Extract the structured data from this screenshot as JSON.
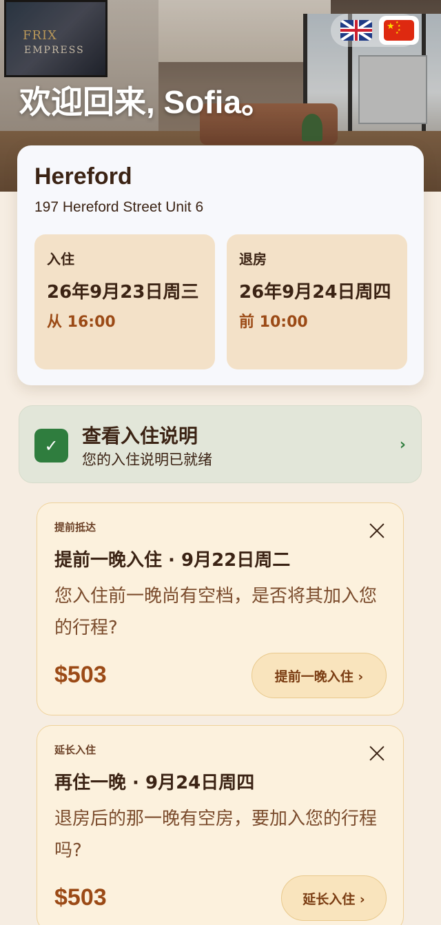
{
  "hero": {
    "welcome": "欢迎回来, Sofia。",
    "tv_title": "FRIX",
    "tv_subtitle": "EMPRESS"
  },
  "language_switcher": {
    "options": [
      "English (UK flag)",
      "中文 (China flag)"
    ],
    "selected": "中文 (China flag)"
  },
  "stay": {
    "property_name": "Hereford",
    "address": "197 Hereford Street Unit 6",
    "checkin": {
      "label": "入住",
      "date": "26年9月23日周三",
      "time": "从 16:00"
    },
    "checkout": {
      "label": "退房",
      "date": "26年9月24日周四",
      "time": "前 10:00"
    }
  },
  "instructions": {
    "title": "查看入住说明",
    "subtitle": "您的入住说明已就绪",
    "chevron": "›"
  },
  "offers": [
    {
      "tag": "提前抵达",
      "headline": "提前一晚入住 · 9月22日周二",
      "description": "您入住前一晚尚有空档，是否将其加入您的行程?",
      "price": "$503",
      "cta": "提前一晚入住 ›"
    },
    {
      "tag": "延长入住",
      "headline": "再住一晚 · 9月24日周四",
      "description": "退房后的那一晚有空房，要加入您的行程吗?",
      "price": "$503",
      "cta": "延长入住 ›"
    }
  ],
  "colors": {
    "page_bg": "#f6ede2",
    "accent_brown": "#9b4a16",
    "success_green": "#2f7d3e",
    "offer_bg": "#fcf1dd"
  }
}
